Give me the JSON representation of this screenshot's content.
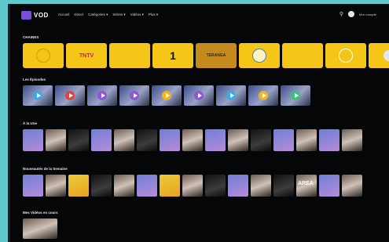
{
  "app": {
    "logo_text": "VOD"
  },
  "nav": {
    "items": [
      "Accueil",
      "Direct",
      "Catégories ▾",
      "Séries ▾",
      "Vidéos ▾",
      "Plus ▾"
    ]
  },
  "header": {
    "user_label": "Mon compte"
  },
  "sections": {
    "channels": {
      "title": "CHAINES"
    },
    "episodes": {
      "title": "Les Épisodes"
    },
    "featured": {
      "title": "À la Une"
    },
    "weekly": {
      "title": "Nouveautés de la Semaine"
    },
    "continue": {
      "title": "Mes Vidéos en cours"
    }
  },
  "channels": [
    {
      "label": "",
      "style": "logo-circle"
    },
    {
      "label": "TNTV",
      "style": "text"
    },
    {
      "label": "",
      "style": "small"
    },
    {
      "label": "1",
      "style": "big-number"
    },
    {
      "label": "TERANGA",
      "style": "dark"
    },
    {
      "label": "",
      "style": "emblem"
    },
    {
      "label": "",
      "style": "small"
    },
    {
      "label": "",
      "style": "logo-circle"
    },
    {
      "label": "",
      "style": "globe"
    }
  ],
  "episodes": [
    {
      "play_color": "#3fa9e0"
    },
    {
      "play_color": "#e0443f"
    },
    {
      "play_color": "#8e58d4"
    },
    {
      "play_color": "#8e58d4"
    },
    {
      "play_color": "#f0b41c"
    },
    {
      "play_color": "#8e58d4"
    },
    {
      "play_color": "#3fa9e0"
    },
    {
      "play_color": "#f0b41c"
    },
    {
      "play_color": "#3dbf7d"
    }
  ],
  "posters_featured": [
    "tint",
    "photo",
    "dark",
    "tint",
    "photo",
    "dark",
    "tint",
    "photo",
    "tint",
    "photo",
    "dark",
    "tint",
    "photo",
    "tint",
    "photo"
  ],
  "posters_weekly": [
    "tint",
    "photo",
    "yellow",
    "dark",
    "photo",
    "tint",
    "yellow",
    "photo",
    "dark",
    "tint",
    "photo",
    "dark",
    "photo",
    "tint",
    "photo"
  ],
  "weekly_text": {
    "area": "AREA"
  },
  "colors": {
    "accent": "#7a4fd8",
    "channel_bg": "#f5c518",
    "background": "#050608"
  }
}
